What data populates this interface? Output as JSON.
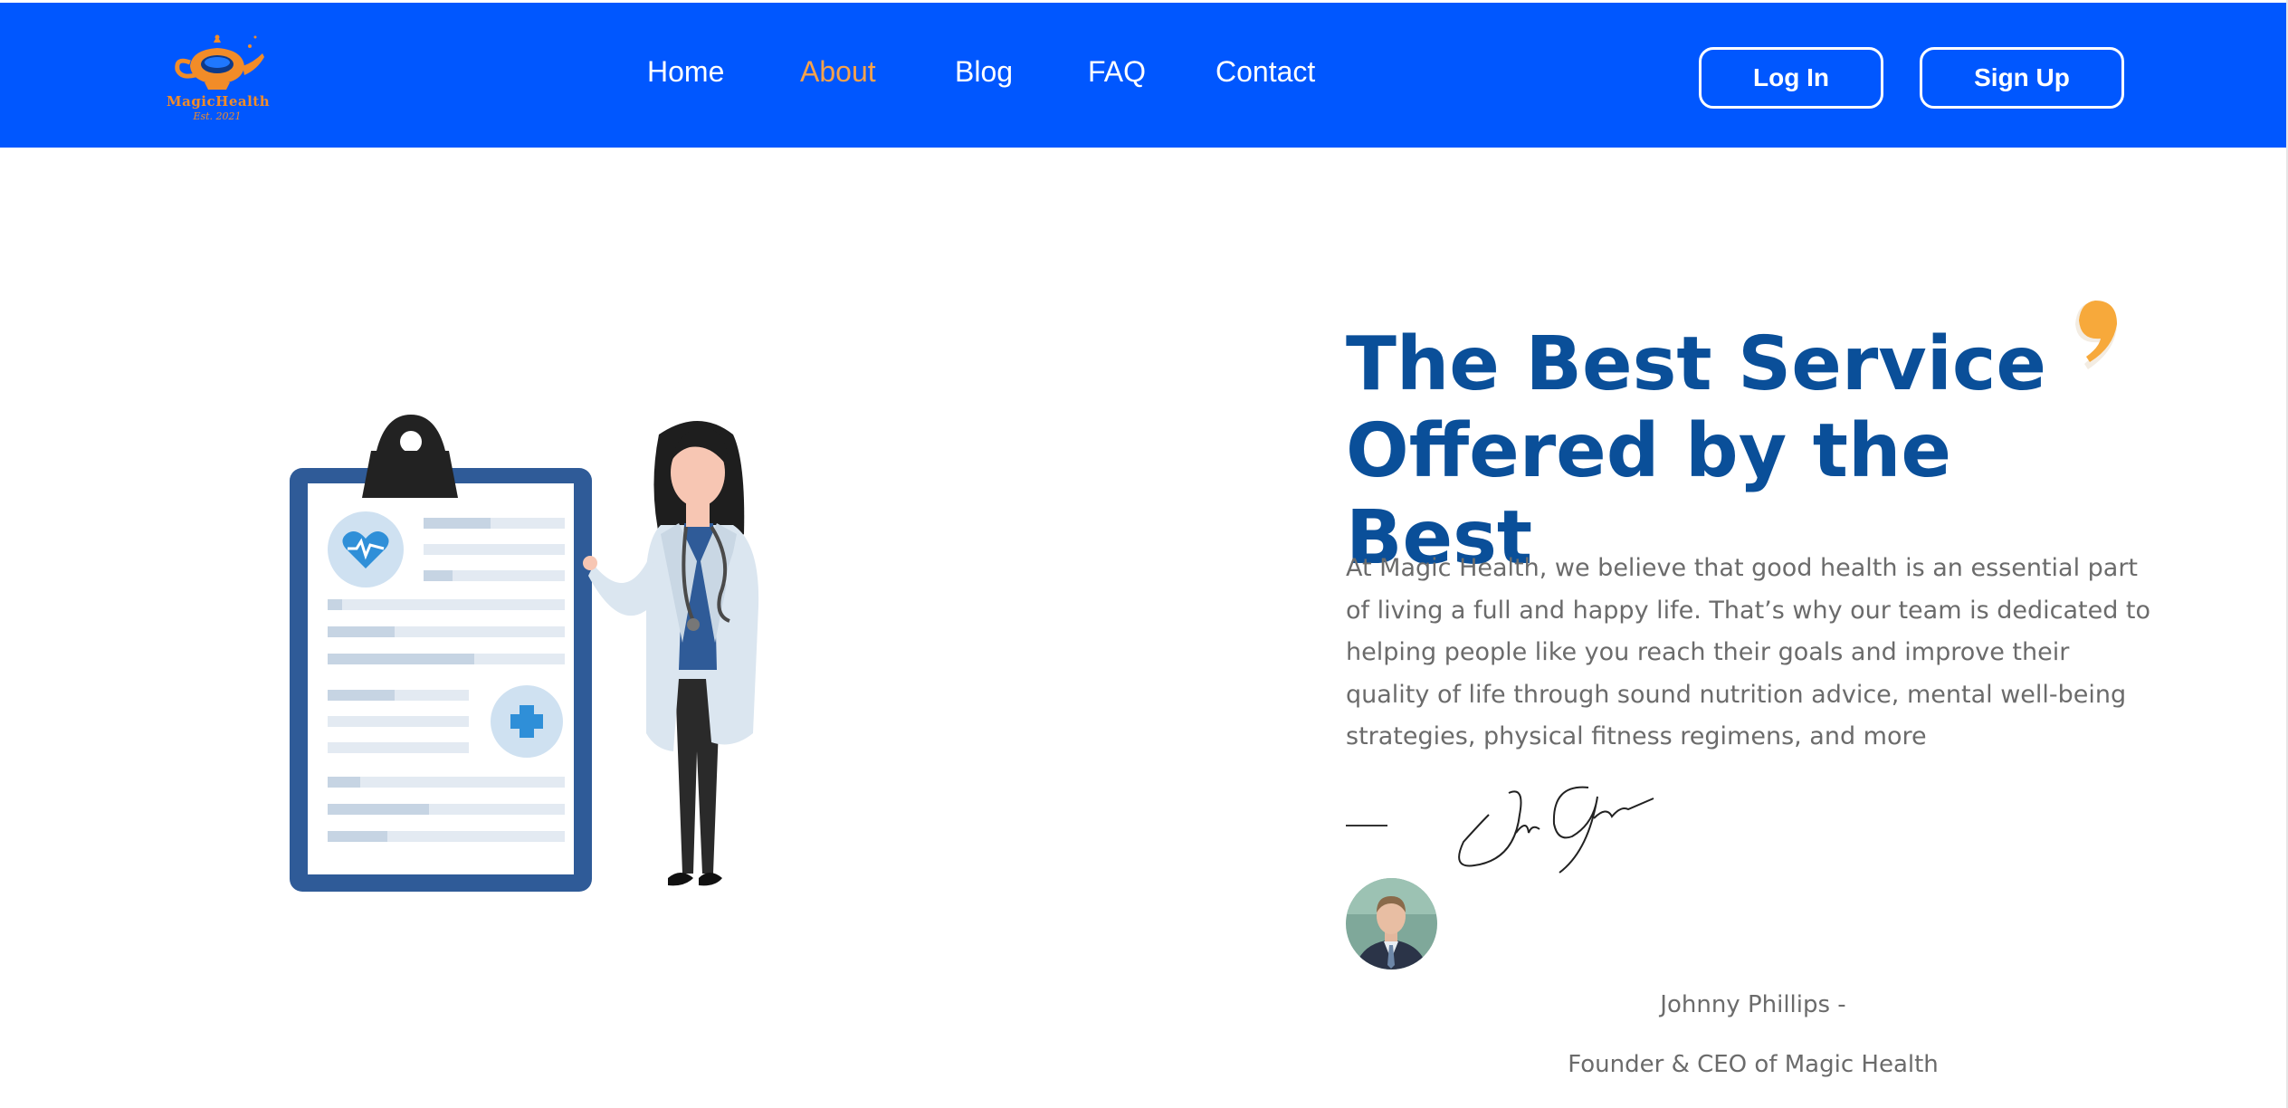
{
  "header": {
    "logo": {
      "text": "MagicHealth",
      "subtext": "Est. 2021",
      "icon": "magic-lamp-icon"
    },
    "nav": [
      {
        "label": "Home",
        "active": false
      },
      {
        "label": "About",
        "active": true
      },
      {
        "label": "Blog",
        "active": false
      },
      {
        "label": "FAQ",
        "active": false
      },
      {
        "label": "Contact",
        "active": false
      }
    ],
    "login_label": "Log In",
    "signup_label": "Sign Up"
  },
  "hero": {
    "illustration": "doctor-with-clipboard-illustration",
    "headline_line1": "The Best Service",
    "headline_line2": "Offered by the Best",
    "quote_icon": "quote-mark-icon",
    "paragraph": "At Magic Health, we believe that good health is an essential part of living a full and happy life. That’s why our team is dedicated to helping people like you reach their goals and improve their quality of life through sound nutrition advice, mental well-being strategies, physical fitness regimens, and more",
    "author_name": "Johnny Phillips -",
    "author_title": "Founder & CEO of Magic Health"
  },
  "colors": {
    "header_bg": "#0057ff",
    "nav_active": "#f6a24b",
    "headline": "#0a4f99",
    "body_text": "#6b6b6b",
    "accent_orange": "#f7a93b",
    "clipboard_blue": "#2f5b98"
  }
}
